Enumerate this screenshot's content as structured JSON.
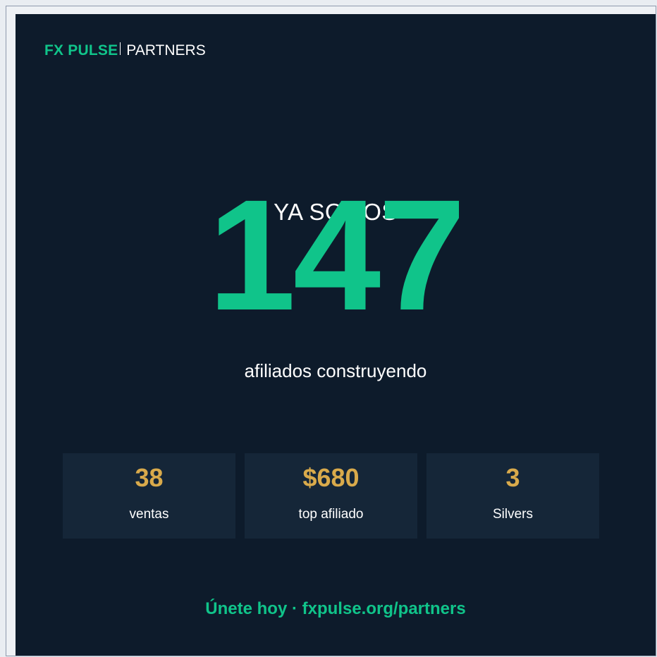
{
  "brand": {
    "name": "FX PULSE",
    "sub": "PARTNERS"
  },
  "hero": {
    "kicker": "YA SOMOS",
    "number": "147",
    "caption": "afiliados construyendo"
  },
  "stats": [
    {
      "value": "38",
      "label": "ventas"
    },
    {
      "value": "$680",
      "label": "top afiliado"
    },
    {
      "value": "3",
      "label": "Silvers"
    }
  ],
  "cta": "Únete hoy · fxpulse.org/partners",
  "colors": {
    "background": "#0d1b2b",
    "accent": "#10c48a",
    "gold": "#d9aa4b",
    "stat_box": "#152638",
    "text": "#ffffff"
  }
}
